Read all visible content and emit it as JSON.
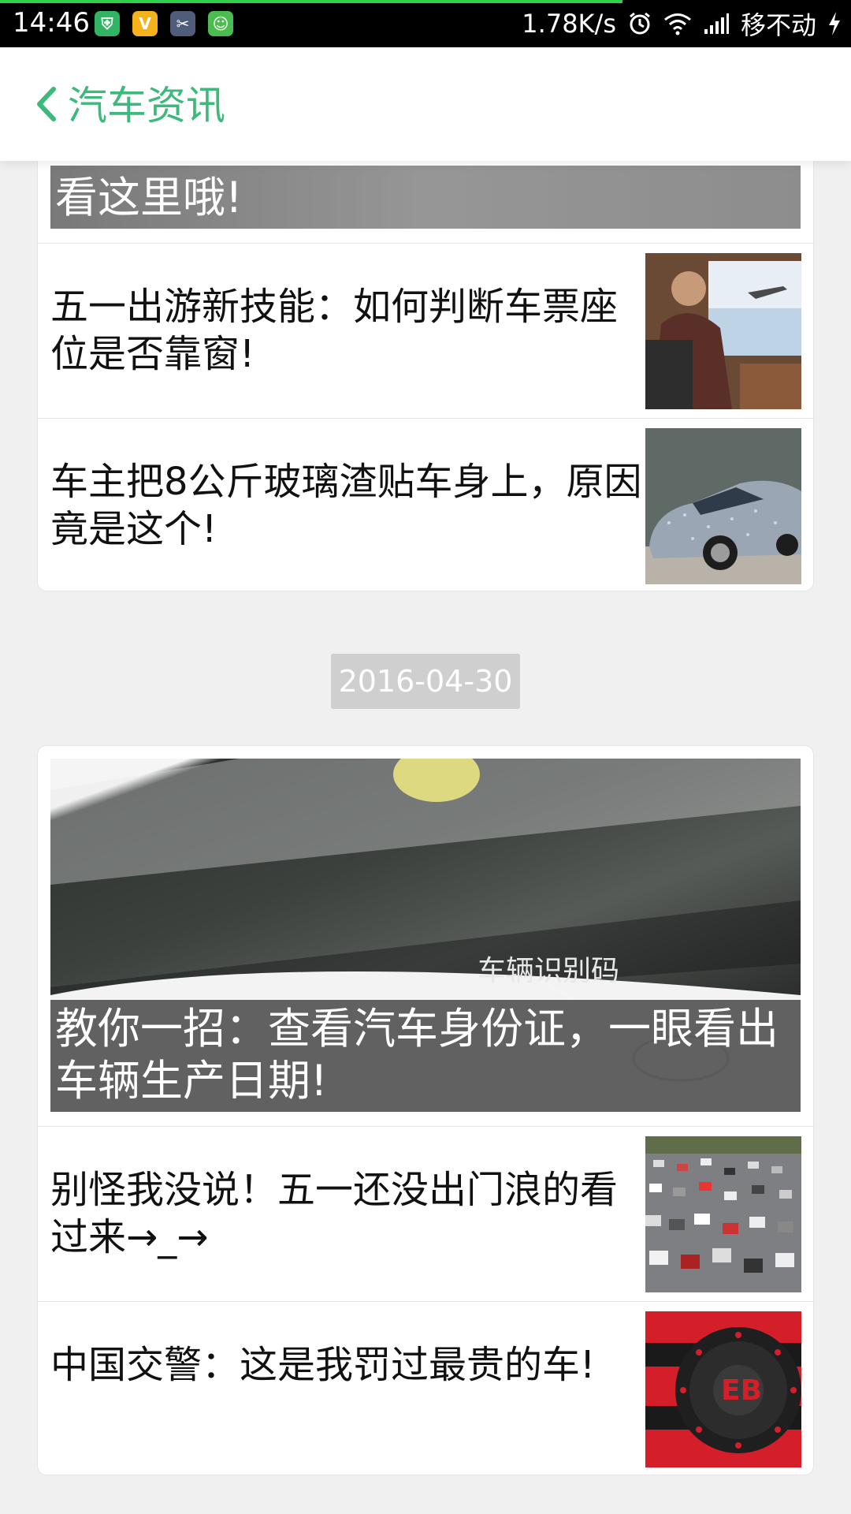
{
  "status_bar": {
    "time": "14:46",
    "speed": "1.78K/s",
    "carrier": "移不动",
    "app_icons": [
      "shield-icon",
      "v-app-icon",
      "scissors-app-icon",
      "android-app-icon"
    ]
  },
  "header": {
    "title": "汽车资讯"
  },
  "group1": {
    "cover_caption": "看这里哦!",
    "items": [
      {
        "title": "五一出游新技能：如何判断车票座位是否靠窗!"
      },
      {
        "title": "车主把8公斤玻璃渣贴车身上，原因竟是这个!"
      }
    ]
  },
  "date_label": "2016-04-30",
  "group2": {
    "cover_watermark": "车辆识别码",
    "cover_caption": "教你一招：查看汽车身份证，一眼看出车辆生产日期!",
    "items": [
      {
        "title": "别怪我没说！五一还没出门浪的看过来→_→"
      },
      {
        "title": "中国交警：这是我罚过最贵的车!"
      }
    ]
  },
  "colors": {
    "accent": "#3cb97b",
    "progress": "#2fd04a"
  }
}
